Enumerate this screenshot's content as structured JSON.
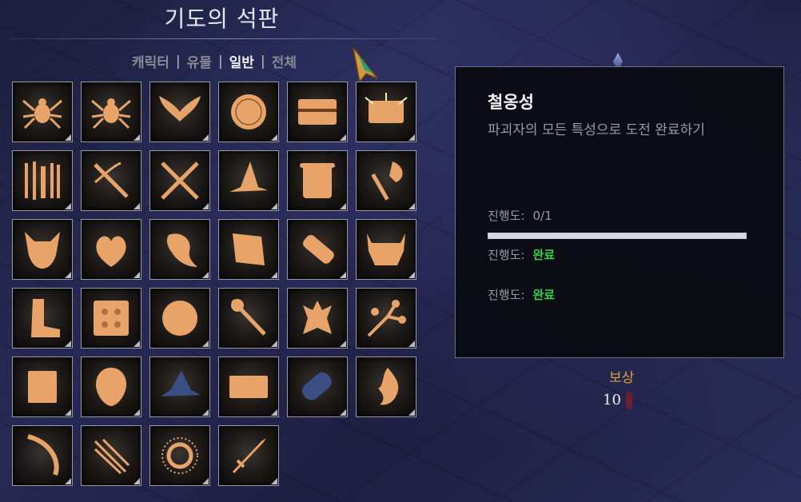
{
  "title": "기도의 석판",
  "filters": [
    {
      "label": "캐릭터",
      "active": false
    },
    {
      "label": "유물",
      "active": false
    },
    {
      "label": "일반",
      "active": true
    },
    {
      "label": "전체",
      "active": false
    }
  ],
  "filter_separator": "|",
  "slots": [
    {
      "icon": "spider-icon",
      "color": "#e8a468"
    },
    {
      "icon": "spider-icon",
      "color": "#e8a468"
    },
    {
      "icon": "wings-icon",
      "color": "#e8a468"
    },
    {
      "icon": "coin-icon",
      "color": "#e8a468"
    },
    {
      "icon": "chest-icon",
      "color": "#e8a468"
    },
    {
      "icon": "glowing-chest-icon",
      "color": "#e8a468"
    },
    {
      "icon": "weapon-rack-icon",
      "color": "#e8a468"
    },
    {
      "icon": "crossbow-icon",
      "color": "#e8a468"
    },
    {
      "icon": "crossed-blades-icon",
      "color": "#e8a468"
    },
    {
      "icon": "witch-hat-icon",
      "color": "#e8a468"
    },
    {
      "icon": "scroll-icon",
      "color": "#e8a468"
    },
    {
      "icon": "axe-icon",
      "color": "#e8a468"
    },
    {
      "icon": "demon-skull-icon",
      "color": "#e8a468"
    },
    {
      "icon": "heart-icon",
      "color": "#e8a468"
    },
    {
      "icon": "leaf-icon",
      "color": "#e8a468"
    },
    {
      "icon": "parchment-icon",
      "color": "#e8a468"
    },
    {
      "icon": "bandage-icon",
      "color": "#e8a468"
    },
    {
      "icon": "fanged-jaw-icon",
      "color": "#e8a468"
    },
    {
      "icon": "boot-icon",
      "color": "#e8a468"
    },
    {
      "icon": "shield-pattern-icon",
      "color": "#e8a468"
    },
    {
      "icon": "orb-icon",
      "color": "#e8a468"
    },
    {
      "icon": "sceptre-icon",
      "color": "#e8a468"
    },
    {
      "icon": "imp-icon",
      "color": "#e8a468"
    },
    {
      "icon": "branch-icon",
      "color": "#e8a468"
    },
    {
      "icon": "tome-icon",
      "color": "#e8a468"
    },
    {
      "icon": "mask-icon",
      "color": "#e8a468"
    },
    {
      "icon": "wizard-hat-icon",
      "color": "#3c4e86"
    },
    {
      "icon": "banner-icon",
      "color": "#e8a468"
    },
    {
      "icon": "rolled-scroll-icon",
      "color": "#3c4e86"
    },
    {
      "icon": "flame-emblem-icon",
      "color": "#e8a468"
    },
    {
      "icon": "bow-icon",
      "color": "#e8a468"
    },
    {
      "icon": "wands-icon",
      "color": "#e8a468"
    },
    {
      "icon": "sun-ring-icon",
      "color": "#e8a468"
    },
    {
      "icon": "sword-icon",
      "color": "#e8a468"
    }
  ],
  "panel": {
    "name": "철옹성",
    "description": "파괴자의 모든 특성으로 도전 완료하기",
    "progress_label": "진행도:",
    "progress_value": "0/1",
    "progress_fraction": 1.0,
    "rows": [
      {
        "label": "진행도:",
        "status": "완료"
      },
      {
        "label": "진행도:",
        "status": "완료"
      }
    ]
  },
  "reward": {
    "label": "보상",
    "count": "10"
  },
  "colors": {
    "accent_done": "#2fd04a",
    "reward_gold": "#d9a23c"
  }
}
